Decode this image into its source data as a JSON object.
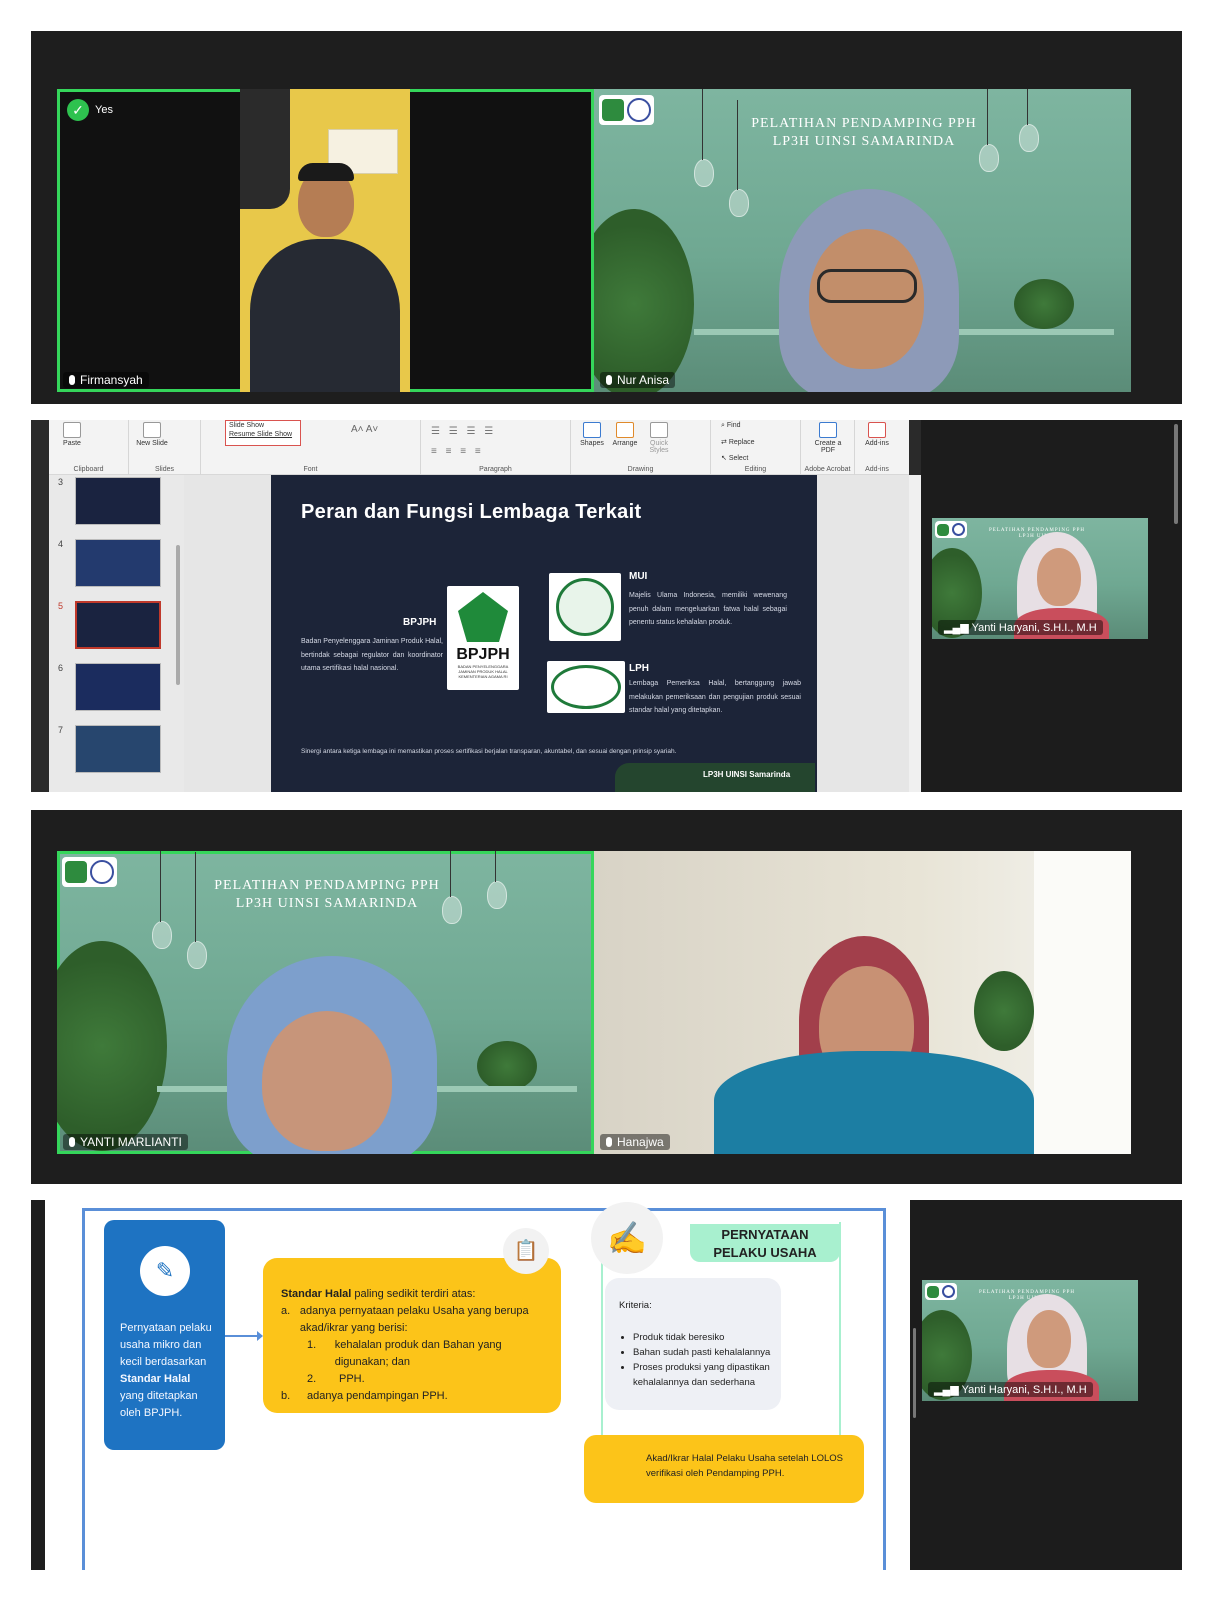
{
  "panel1": {
    "left_participant": {
      "name": "Firmansyah",
      "reaction": "Yes"
    },
    "right_participant": {
      "name": "Nur Anisa"
    },
    "background_title_line1": "PELATIHAN PENDAMPING PPH",
    "background_title_line2": "LP3H UINSI SAMARINDA"
  },
  "panel2": {
    "ribbon": {
      "slideshow_menu": [
        "Slide Show",
        "Resume Slide Show"
      ],
      "groups": [
        "Clipboard",
        "Slides",
        "Font",
        "Paragraph",
        "Drawing",
        "Editing",
        "Adobe Acrobat",
        "Add-ins"
      ],
      "buttons": {
        "paste": "Paste",
        "new_slide": "New Slide",
        "shapes": "Shapes",
        "arrange": "Arrange",
        "quick_styles": "Quick Styles",
        "find": "Find",
        "replace": "Replace",
        "select": "Select",
        "create_pdf": "Create a PDF",
        "addins": "Add-ins"
      }
    },
    "thumbnails": [
      "3",
      "4",
      "5",
      "6",
      "7"
    ],
    "slide": {
      "title": "Peran dan Fungsi Lembaga Terkait",
      "bpjph_label": "BPJPH",
      "bpjph_logo_text": "BPJPH",
      "bpjph_logo_sub": "BADAN PENYELENGGARA JAMINAN PRODUK HALAL KEMENTERIAN AGAMA RI",
      "bpjph_desc": "Badan Penyelenggara Jaminan Produk Halal, bertindak sebagai regulator dan koordinator utama sertifikasi halal nasional.",
      "mui_label": "MUI",
      "mui_desc": "Majelis Ulama Indonesia, memiliki wewenang penuh dalam mengeluarkan fatwa halal sebagai penentu status kehalalan produk.",
      "lph_label": "LPH",
      "lph_desc": "Lembaga Pemeriksa Halal, bertanggung jawab melakukan pemeriksaan dan pengujian produk sesuai standar halal yang ditetapkan.",
      "footer": "Sinergi antara ketiga lembaga ini memastikan proses sertifikasi berjalan transparan, akuntabel, dan sesuai dengan prinsip syariah.",
      "badge": "LP3H UINSI Samarinda"
    },
    "side_video": {
      "name": "Yanti Haryani, S.H.I., M.H",
      "bg_title": "PELATIHAN PENDAMPING PPH LP3H UINSI"
    }
  },
  "panel3": {
    "left_participant": {
      "name": "YANTI MARLIANTI"
    },
    "right_participant": {
      "name": "Hanajwa"
    },
    "background_title_line1": "PELATIHAN PENDAMPING PPH",
    "background_title_line2": "LP3H UINSI SAMARINDA"
  },
  "panel4": {
    "blue_card": {
      "text_before": "Pernyataan pelaku usaha mikro dan kecil berdasarkan",
      "bold": "Standar Halal",
      "text_after": "yang ditetapkan oleh BPJPH."
    },
    "yellow_card": {
      "bold": "Standar Halal",
      "intro": " paling sedikit terdiri atas:",
      "a_marker": "a.",
      "a_text": "adanya pernyataan pelaku Usaha yang berupa akad/ikrar yang berisi:",
      "n1": "1.",
      "n1_text": "kehalalan produk dan Bahan yang digunakan; dan",
      "n2": "2.",
      "n2_text": "PPH.",
      "b_marker": "b.",
      "b_text": "adanya pendampingan PPH."
    },
    "pill_title_line1": "PERNYATAAN",
    "pill_title_line2": "PELAKU USAHA",
    "kriteria": {
      "title": "Kriteria:",
      "items": [
        "Produk tidak beresiko",
        "Bahan sudah pasti kehalalannya",
        "Proses produksi yang dipastikan kehalalannya dan sederhana"
      ]
    },
    "akad_box": "Akad/Ikrar Halal Pelaku Usaha setelah LOLOS verifikasi oleh Pendamping PPH.",
    "side_video": {
      "name": "Yanti Haryani, S.H.I., M.H",
      "bg_title": "PELATIHAN PENDAMPING PPH LP3H UINSI"
    }
  }
}
